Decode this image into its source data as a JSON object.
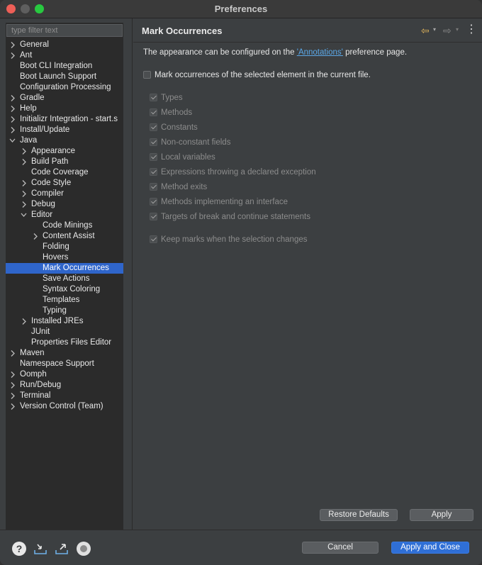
{
  "window": {
    "title": "Preferences"
  },
  "filter": {
    "placeholder": "type filter text"
  },
  "tree": [
    {
      "label": "General",
      "expandable": true,
      "expanded": false,
      "depth": 0
    },
    {
      "label": "Ant",
      "expandable": true,
      "expanded": false,
      "depth": 0
    },
    {
      "label": "Boot CLI Integration",
      "expandable": false,
      "depth": 0
    },
    {
      "label": "Boot Launch Support",
      "expandable": false,
      "depth": 0
    },
    {
      "label": "Configuration Processing",
      "expandable": false,
      "depth": 0
    },
    {
      "label": "Gradle",
      "expandable": true,
      "expanded": false,
      "depth": 0
    },
    {
      "label": "Help",
      "expandable": true,
      "expanded": false,
      "depth": 0
    },
    {
      "label": "Initializr Integration - start.s",
      "expandable": true,
      "expanded": false,
      "depth": 0
    },
    {
      "label": "Install/Update",
      "expandable": true,
      "expanded": false,
      "depth": 0
    },
    {
      "label": "Java",
      "expandable": true,
      "expanded": true,
      "depth": 0
    },
    {
      "label": "Appearance",
      "expandable": true,
      "expanded": false,
      "depth": 1
    },
    {
      "label": "Build Path",
      "expandable": true,
      "expanded": false,
      "depth": 1
    },
    {
      "label": "Code Coverage",
      "expandable": false,
      "depth": 1
    },
    {
      "label": "Code Style",
      "expandable": true,
      "expanded": false,
      "depth": 1
    },
    {
      "label": "Compiler",
      "expandable": true,
      "expanded": false,
      "depth": 1
    },
    {
      "label": "Debug",
      "expandable": true,
      "expanded": false,
      "depth": 1
    },
    {
      "label": "Editor",
      "expandable": true,
      "expanded": true,
      "depth": 1
    },
    {
      "label": "Code Minings",
      "expandable": false,
      "depth": 2
    },
    {
      "label": "Content Assist",
      "expandable": true,
      "expanded": false,
      "depth": 2
    },
    {
      "label": "Folding",
      "expandable": false,
      "depth": 2
    },
    {
      "label": "Hovers",
      "expandable": false,
      "depth": 2
    },
    {
      "label": "Mark Occurrences",
      "expandable": false,
      "depth": 2,
      "selected": true
    },
    {
      "label": "Save Actions",
      "expandable": false,
      "depth": 2
    },
    {
      "label": "Syntax Coloring",
      "expandable": false,
      "depth": 2
    },
    {
      "label": "Templates",
      "expandable": false,
      "depth": 2
    },
    {
      "label": "Typing",
      "expandable": false,
      "depth": 2
    },
    {
      "label": "Installed JREs",
      "expandable": true,
      "expanded": false,
      "depth": 1
    },
    {
      "label": "JUnit",
      "expandable": false,
      "depth": 1
    },
    {
      "label": "Properties Files Editor",
      "expandable": false,
      "depth": 1
    },
    {
      "label": "Maven",
      "expandable": true,
      "expanded": false,
      "depth": 0
    },
    {
      "label": "Namespace Support",
      "expandable": false,
      "depth": 0
    },
    {
      "label": "Oomph",
      "expandable": true,
      "expanded": false,
      "depth": 0
    },
    {
      "label": "Run/Debug",
      "expandable": true,
      "expanded": false,
      "depth": 0
    },
    {
      "label": "Terminal",
      "expandable": true,
      "expanded": false,
      "depth": 0
    },
    {
      "label": "Version Control (Team)",
      "expandable": true,
      "expanded": false,
      "depth": 0
    }
  ],
  "page": {
    "title": "Mark Occurrences",
    "description_before": "The appearance can be configured on the ",
    "description_link": "'Annotations'",
    "description_after": " preference page.",
    "main_checkbox": {
      "label": "Mark occurrences of the selected element in the current file.",
      "checked": false
    },
    "options": [
      {
        "label": "Types",
        "checked": true,
        "enabled": false
      },
      {
        "label": "Methods",
        "checked": true,
        "enabled": false
      },
      {
        "label": "Constants",
        "checked": true,
        "enabled": false
      },
      {
        "label": "Non-constant fields",
        "checked": true,
        "enabled": false
      },
      {
        "label": "Local variables",
        "checked": true,
        "enabled": false
      },
      {
        "label": "Expressions throwing a declared exception",
        "checked": true,
        "enabled": false
      },
      {
        "label": "Method exits",
        "checked": true,
        "enabled": false
      },
      {
        "label": "Methods implementing an interface",
        "checked": true,
        "enabled": false
      },
      {
        "label": "Targets of break and continue statements",
        "checked": true,
        "enabled": false
      }
    ],
    "keep_marks": {
      "label": "Keep marks when the selection changes",
      "checked": true,
      "enabled": false
    },
    "restore_defaults_label": "Restore Defaults",
    "apply_label": "Apply"
  },
  "footer": {
    "help_icon_glyph": "?",
    "cancel_label": "Cancel",
    "apply_close_label": "Apply and Close"
  },
  "colors": {
    "selection": "#2f65ca",
    "link": "#5ba8e8",
    "primary_button": "#2f6fd6",
    "back_arrow": "#e0b45b"
  },
  "icons": {
    "back": "arrow-left-icon",
    "forward": "arrow-right-icon",
    "menu": "vertical-dots-icon",
    "help": "help-icon",
    "import": "import-icon",
    "export": "export-icon",
    "record": "record-icon"
  }
}
